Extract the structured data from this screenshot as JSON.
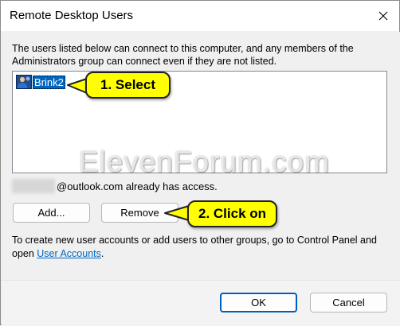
{
  "window": {
    "title": "Remote Desktop Users"
  },
  "description": "The users listed below can connect to this computer, and any members of the Administrators group can connect even if they are not listed.",
  "user_list": {
    "items": [
      {
        "label": "Brink2",
        "icon": "user-icon",
        "selected": true
      }
    ]
  },
  "callouts": {
    "step1": "1. Select",
    "step2": "2. Click on",
    "color": "#ffff00"
  },
  "watermark": "ElevenForum.com",
  "access": {
    "suffix": "@outlook.com already has access."
  },
  "buttons": {
    "add": "Add...",
    "remove": "Remove",
    "ok": "OK",
    "cancel": "Cancel"
  },
  "help": {
    "before": "To create new user accounts or add users to other groups, go to Control Panel and open ",
    "link": "User Accounts",
    "after": "."
  },
  "colors": {
    "accent": "#0067c0",
    "selection": "#0067c0"
  }
}
